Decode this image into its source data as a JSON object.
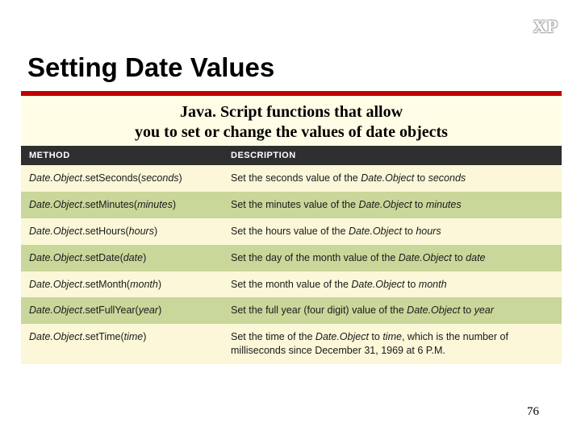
{
  "corner_label": "XP",
  "title": "Setting Date Values",
  "subtitle_line1": "Java. Script functions that allow",
  "subtitle_line2": "you to set or change the values of date objects",
  "headers": {
    "method": "METHOD",
    "desc": "DESCRIPTION"
  },
  "rows": [
    {
      "m_pre": "Date.Object",
      "m_call": ".setSeconds(",
      "m_arg": "seconds",
      "m_post": ")",
      "d_pre": "Set the seconds value of the ",
      "d_obj": "Date.Object",
      "d_mid": " to ",
      "d_arg": "seconds",
      "d_post": ""
    },
    {
      "m_pre": "Date.Object",
      "m_call": ".setMinutes(",
      "m_arg": "minutes",
      "m_post": ")",
      "d_pre": "Set the minutes value of the ",
      "d_obj": "Date.Object",
      "d_mid": " to ",
      "d_arg": "minutes",
      "d_post": ""
    },
    {
      "m_pre": "Date.Object",
      "m_call": ".setHours(",
      "m_arg": "hours",
      "m_post": ")",
      "d_pre": "Set the hours value of the ",
      "d_obj": "Date.Object",
      "d_mid": " to ",
      "d_arg": "hours",
      "d_post": ""
    },
    {
      "m_pre": "Date.Object",
      "m_call": ".setDate(",
      "m_arg": "date",
      "m_post": ")",
      "d_pre": "Set the day of the month value of the ",
      "d_obj": "Date.Object",
      "d_mid": " to ",
      "d_arg": "date",
      "d_post": ""
    },
    {
      "m_pre": "Date.Object",
      "m_call": ".setMonth(",
      "m_arg": "month",
      "m_post": ")",
      "d_pre": "Set the month value of the ",
      "d_obj": "Date.Object",
      "d_mid": " to ",
      "d_arg": "month",
      "d_post": ""
    },
    {
      "m_pre": "Date.Object",
      "m_call": ".setFullYear(",
      "m_arg": "year",
      "m_post": ")",
      "d_pre": "Set the full year (four digit) value of the ",
      "d_obj": "Date.Object",
      "d_mid": " to ",
      "d_arg": "year",
      "d_post": ""
    },
    {
      "m_pre": "Date.Object",
      "m_call": ".setTime(",
      "m_arg": "time",
      "m_post": ")",
      "d_pre": "Set the time of the ",
      "d_obj": "Date.Object",
      "d_mid": " to ",
      "d_arg": "time",
      "d_post": ", which is the number of milliseconds since December 31, 1969 at 6 P.M."
    }
  ],
  "page_number": "76"
}
